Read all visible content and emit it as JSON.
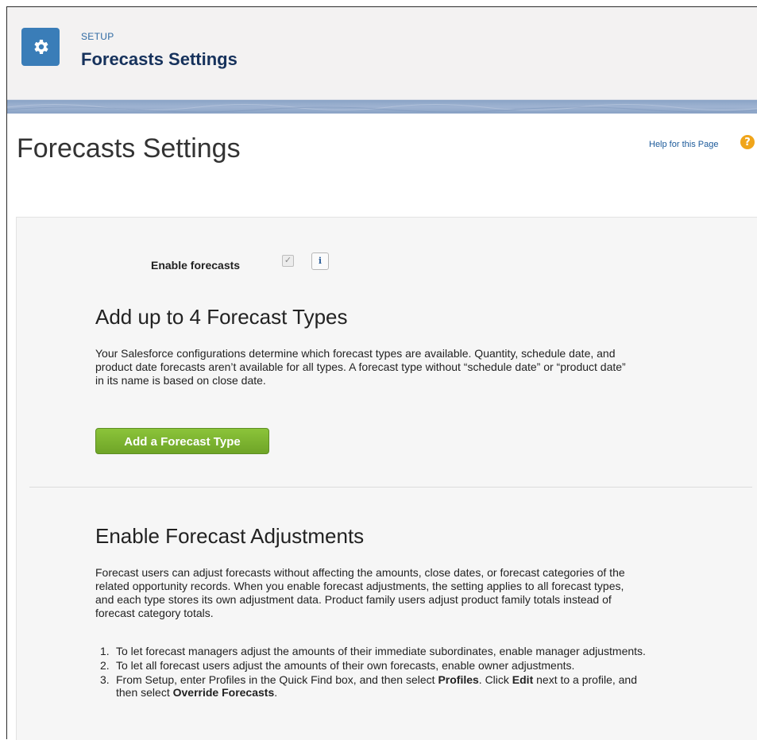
{
  "header": {
    "eyebrow": "SETUP",
    "title": "Forecasts Settings",
    "icon": "gear-icon",
    "icon_color": "#3a7db8"
  },
  "page": {
    "title": "Forecasts Settings",
    "help_link": "Help for this Page",
    "help_icon": "question-icon"
  },
  "settings": {
    "enable_forecasts_label": "Enable forecasts",
    "enable_forecasts_checked": true,
    "info_button": "i"
  },
  "forecast_types": {
    "heading": "Add up to 4 Forecast Types",
    "description": "Your Salesforce configurations determine which forecast types are available. Quantity, schedule date, and product date forecasts aren’t available for all types. A forecast type without “schedule date” or “product date” in its name is based on close date.",
    "add_button": "Add a Forecast Type",
    "add_button_color": "#7ab534"
  },
  "adjustments": {
    "heading": "Enable Forecast Adjustments",
    "description": "Forecast users can adjust forecasts without affecting the amounts, close dates, or forecast categories of the related opportunity records. When you enable forecast adjustments, the setting applies to all forecast types, and each type stores its own adjustment data. Product family users adjust product family totals instead of forecast category totals.",
    "steps": [
      {
        "num": "1.",
        "text": "To let forecast managers adjust the amounts of their immediate subordinates, enable manager adjustments."
      },
      {
        "num": "2.",
        "text": "To let all forecast users adjust the amounts of their own forecasts, enable owner adjustments."
      },
      {
        "num": "3.",
        "text_a": "From Setup, enter Profiles in the Quick Find box, and then select ",
        "bold_a": "Profiles",
        "text_b": ". Click ",
        "bold_b": "Edit",
        "text_c": " next to a profile, and then select ",
        "bold_c": "Override Forecasts",
        "text_d": "."
      }
    ]
  }
}
